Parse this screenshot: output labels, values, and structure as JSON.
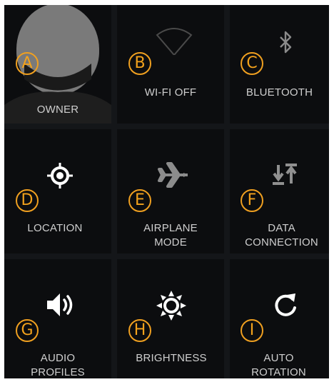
{
  "tiles": [
    {
      "badge": "A",
      "label": "OWNER",
      "icon": "avatar-icon",
      "color": "#cfcfcf"
    },
    {
      "badge": "B",
      "label": "WI-FI OFF",
      "icon": "wifi-icon",
      "color": "#cfcfcf"
    },
    {
      "badge": "C",
      "label": "BLUETOOTH",
      "icon": "bluetooth-icon",
      "color": "#cfcfcf"
    },
    {
      "badge": "D",
      "label": "LOCATION",
      "icon": "location-icon",
      "color": "#ffffff"
    },
    {
      "badge": "E",
      "label": "AIRPLANE\nMODE",
      "icon": "airplane-icon",
      "color": "#cfcfcf"
    },
    {
      "badge": "F",
      "label": "DATA\nCONNECTION",
      "icon": "data-transfer-icon",
      "color": "#cfcfcf"
    },
    {
      "badge": "G",
      "label": "AUDIO\nPROFILES",
      "icon": "speaker-icon",
      "color": "#ffffff"
    },
    {
      "badge": "H",
      "label": "BRIGHTNESS",
      "icon": "sun-icon",
      "color": "#ffffff"
    },
    {
      "badge": "I",
      "label": "AUTO\nROTATION",
      "icon": "rotate-icon",
      "color": "#ffffff"
    }
  ],
  "colors": {
    "badge": "#f0a020",
    "background": "#0c0d0f",
    "grid": "#141619"
  }
}
